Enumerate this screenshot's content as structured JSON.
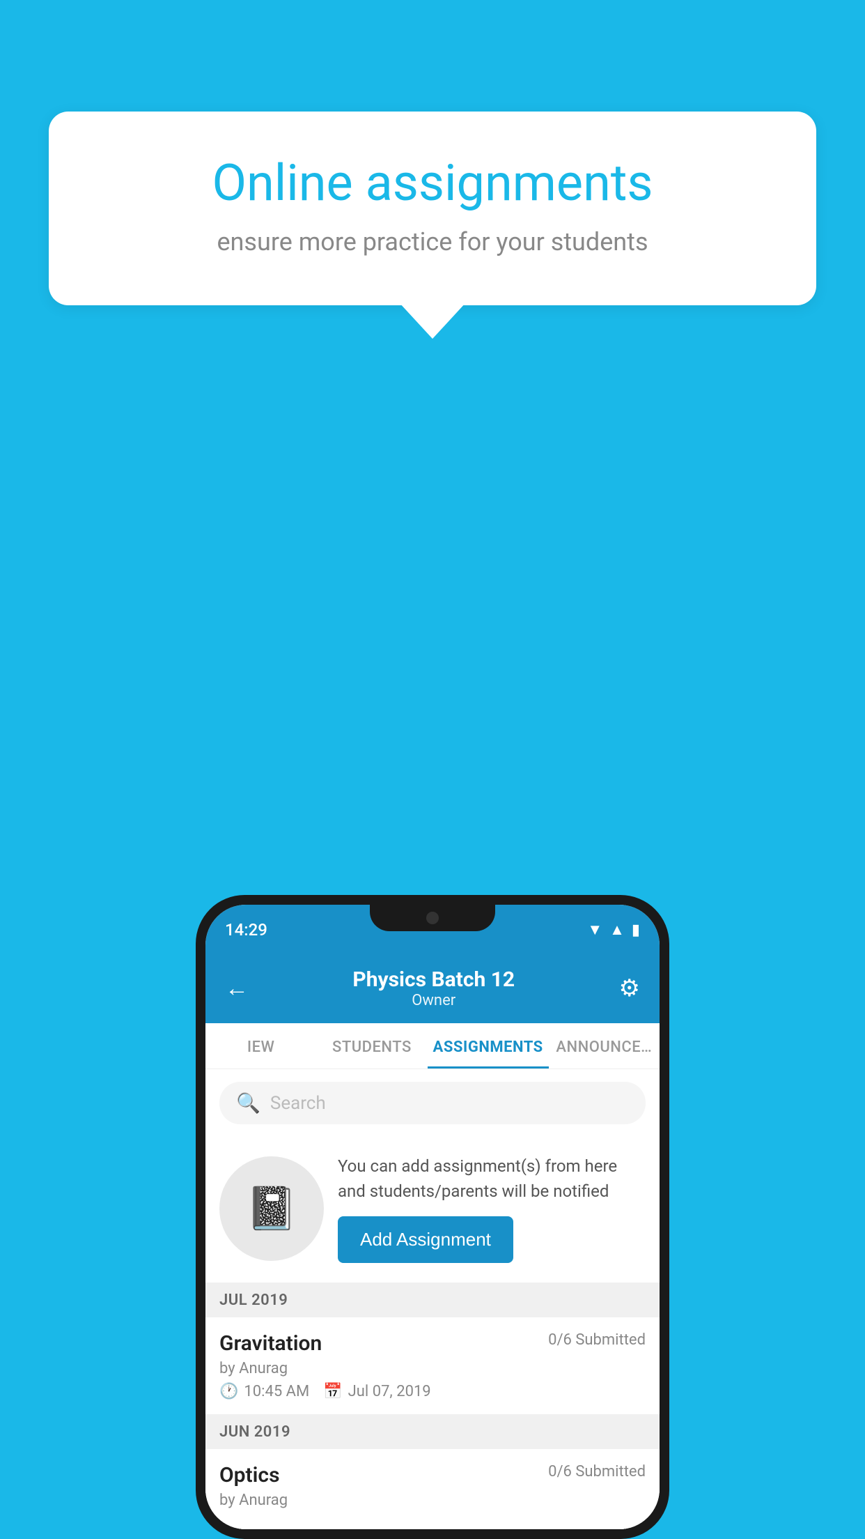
{
  "background_color": "#1ab8e8",
  "speech_bubble": {
    "title": "Online assignments",
    "subtitle": "ensure more practice for your students"
  },
  "phone": {
    "status_bar": {
      "time": "14:29"
    },
    "header": {
      "title": "Physics Batch 12",
      "subtitle": "Owner",
      "back_label": "←",
      "gear_label": "⚙"
    },
    "tabs": [
      {
        "label": "IEW",
        "active": false
      },
      {
        "label": "STUDENTS",
        "active": false
      },
      {
        "label": "ASSIGNMENTS",
        "active": true
      },
      {
        "label": "ANNOUNCE…",
        "active": false
      }
    ],
    "search": {
      "placeholder": "Search"
    },
    "promo": {
      "description": "You can add assignment(s) from here and students/parents will be notified",
      "button_label": "Add Assignment"
    },
    "sections": [
      {
        "month": "JUL 2019",
        "assignments": [
          {
            "name": "Gravitation",
            "submitted": "0/6 Submitted",
            "author": "by Anurag",
            "time": "10:45 AM",
            "date": "Jul 07, 2019"
          }
        ]
      },
      {
        "month": "JUN 2019",
        "assignments": [
          {
            "name": "Optics",
            "submitted": "0/6 Submitted",
            "author": "by Anurag",
            "time": "",
            "date": ""
          }
        ]
      }
    ]
  }
}
